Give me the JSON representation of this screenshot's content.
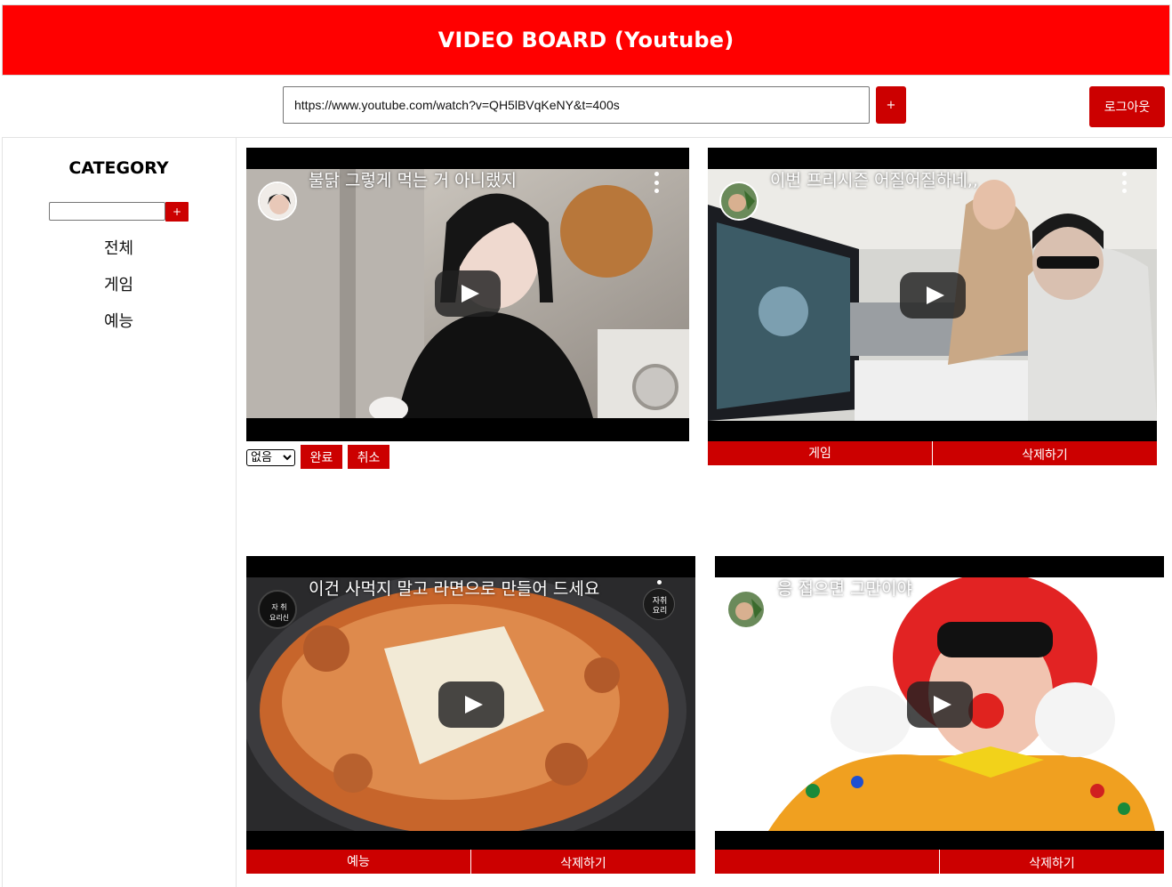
{
  "header": {
    "title": "VIDEO BOARD (Youtube)"
  },
  "toolbar": {
    "url_value": "https://www.youtube.com/watch?v=QH5lBVqKeNY&t=400s",
    "add_label": "+",
    "logout_label": "로그아웃"
  },
  "sidebar": {
    "title": "CATEGORY",
    "input_value": "",
    "add_label": "+",
    "items": [
      {
        "label": "전체"
      },
      {
        "label": "게임"
      },
      {
        "label": "예능"
      }
    ]
  },
  "videos": [
    {
      "title": "불닭 그렇게 먹는 거 아니랬지"
    },
    {
      "title": "이번 프리시즌 어질어질하네,,",
      "category": "게임",
      "delete_label": "삭제하기"
    },
    {
      "title": "이건 사먹지 말고 라면으로 만들어 드세요",
      "category": "예능",
      "delete_label": "삭제하기",
      "channel_badge": "자취\n요리"
    },
    {
      "title": "응 접으면 그만이야",
      "category": "",
      "delete_label": "삭제하기"
    }
  ],
  "editor": {
    "select_value": "없음",
    "done_label": "완료",
    "cancel_label": "취소"
  },
  "colors": {
    "brand_red": "#ff0000",
    "button_red": "#cc0000"
  }
}
